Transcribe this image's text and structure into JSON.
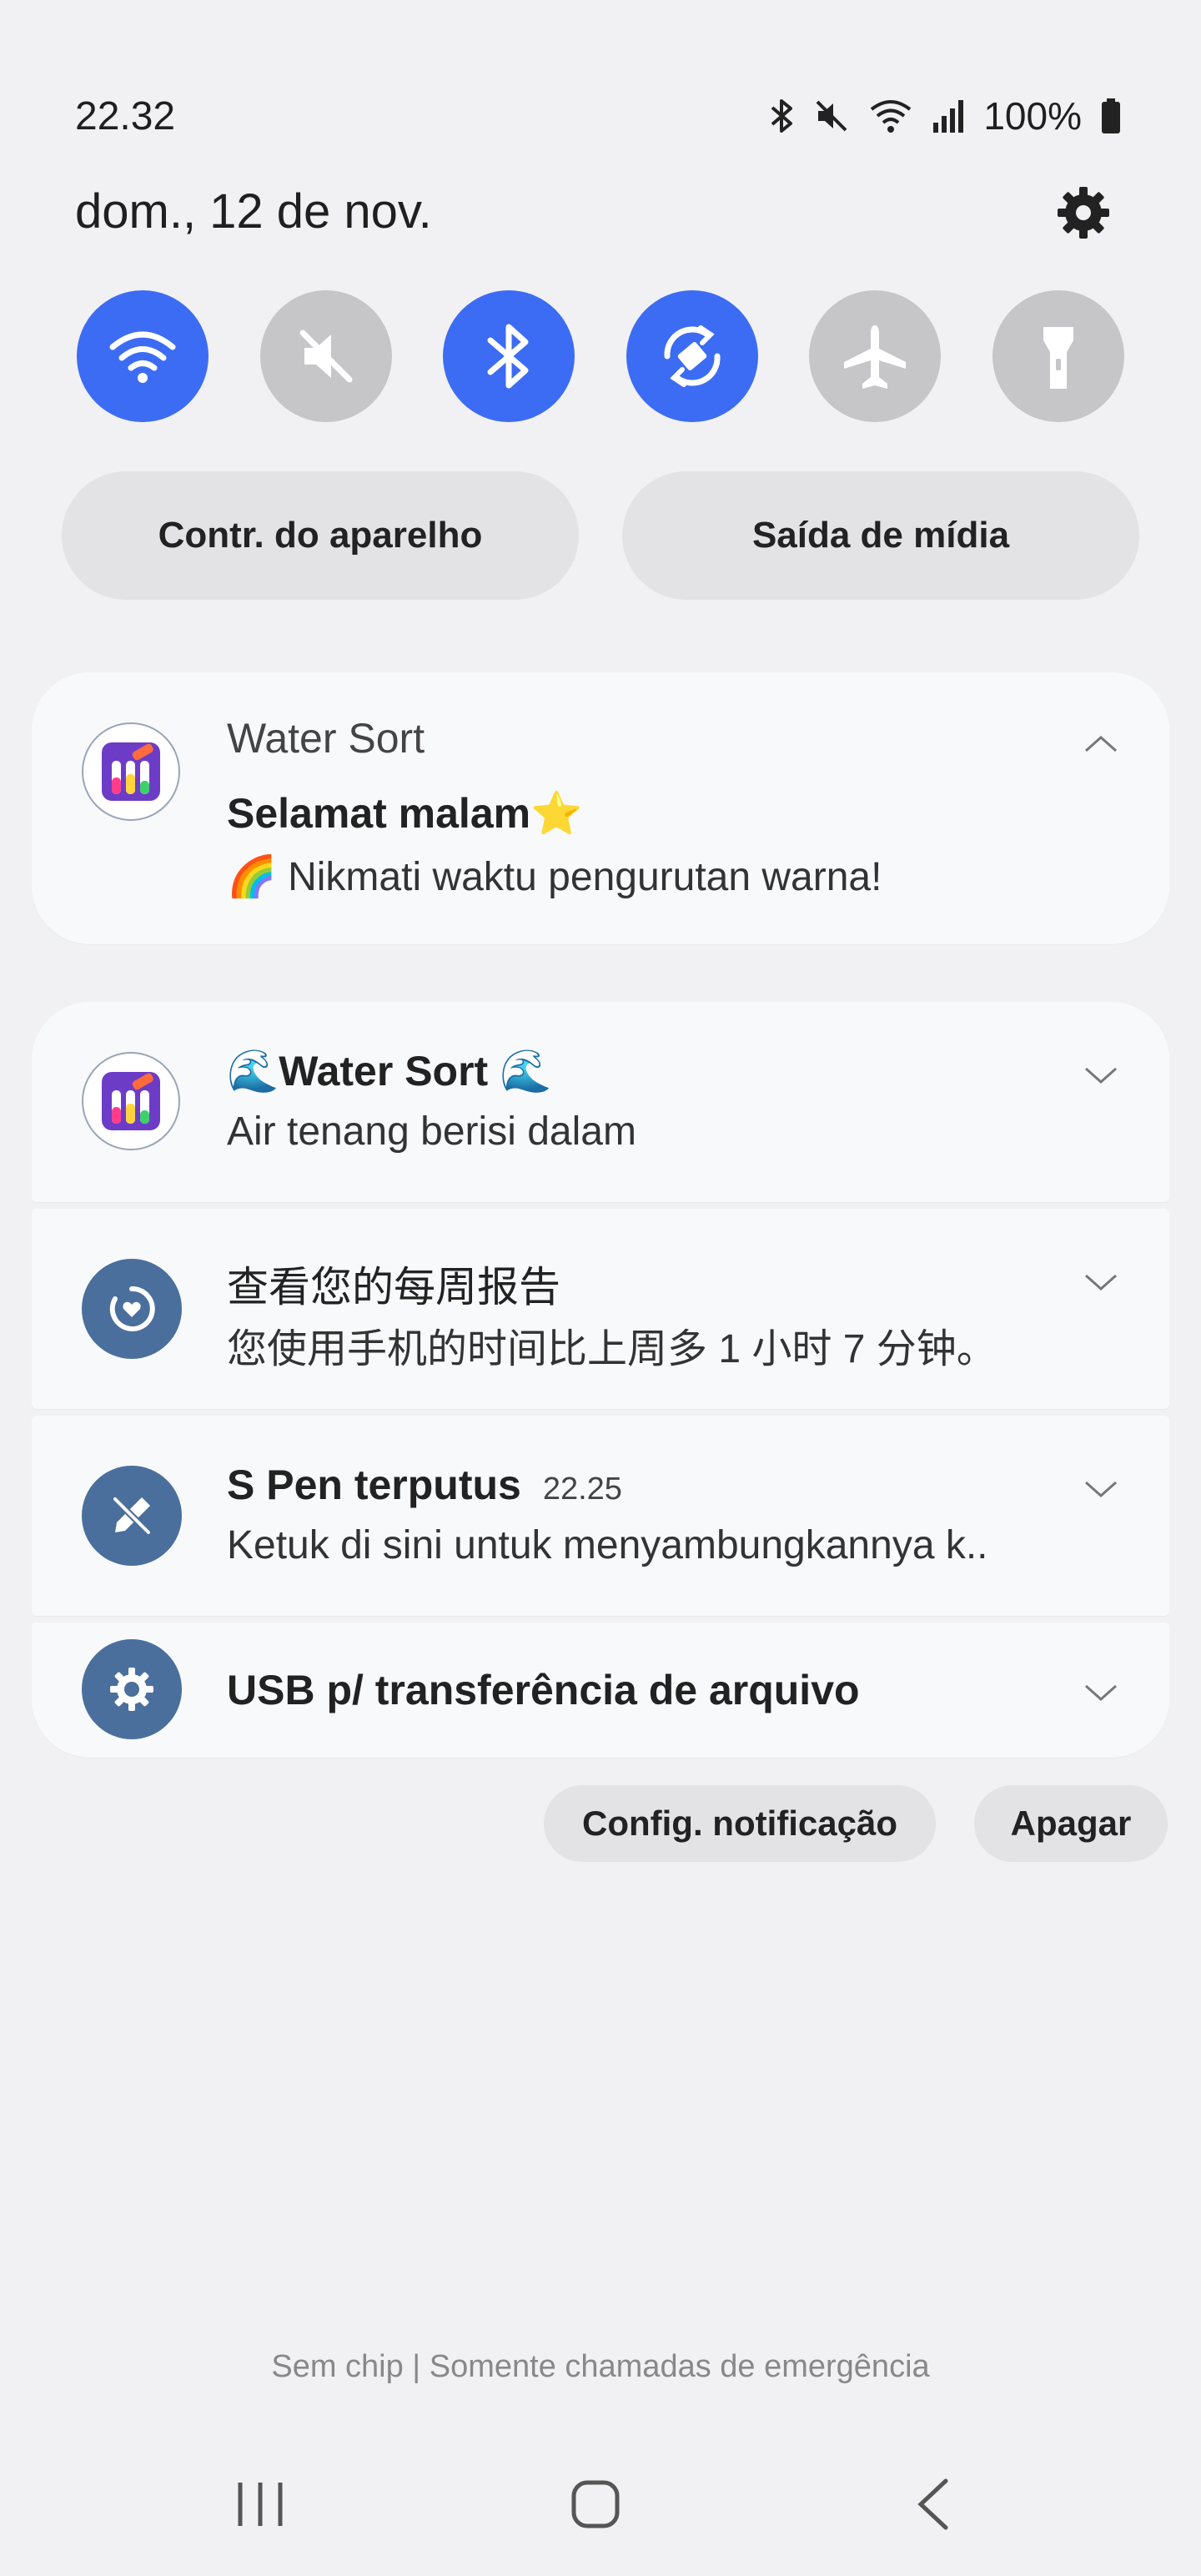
{
  "status_bar": {
    "time": "22.32",
    "battery": "100%",
    "icons": [
      "bluetooth-icon",
      "mute-icon",
      "wifi-icon",
      "signal-icon",
      "battery-icon"
    ]
  },
  "date": "dom., 12 de nov.",
  "quick_settings": [
    {
      "name": "wifi",
      "icon": "wifi-icon",
      "active": true
    },
    {
      "name": "sound",
      "icon": "mute-icon",
      "active": false
    },
    {
      "name": "bluetooth",
      "icon": "bluetooth-icon",
      "active": true
    },
    {
      "name": "auto-rotate",
      "icon": "rotate-icon",
      "active": true
    },
    {
      "name": "airplane",
      "icon": "airplane-icon",
      "active": false
    },
    {
      "name": "flashlight",
      "icon": "flashlight-icon",
      "active": false
    }
  ],
  "pills": {
    "device_control": "Contr. do aparelho",
    "media_output": "Saída de mídia"
  },
  "notifications": [
    {
      "app": "Water Sort",
      "title": "Selamat malam⭐",
      "body": "🌈 Nikmati waktu pengurutan warna!",
      "expanded": true
    },
    {
      "title": "🌊Water Sort 🌊",
      "body": "Air tenang berisi dalam"
    },
    {
      "title": "查看您的每周报告",
      "body": "您使用手机的时间比上周多 1 小时 7 分钟。"
    },
    {
      "title": "S Pen terputus",
      "time": "22.25",
      "body": "Ketuk di sini untuk menyambungkannya k.."
    },
    {
      "title": "USB p/ transferência de arquivo"
    }
  ],
  "actions": {
    "settings": "Config. notificação",
    "clear": "Apagar"
  },
  "carrier": "Sem chip | Somente chamadas de emergência",
  "colors": {
    "accent": "#3d6cf4",
    "inactive": "#c6c6c9",
    "system_icon_bg": "#4a6f9d",
    "background": "#f1f1f3"
  }
}
